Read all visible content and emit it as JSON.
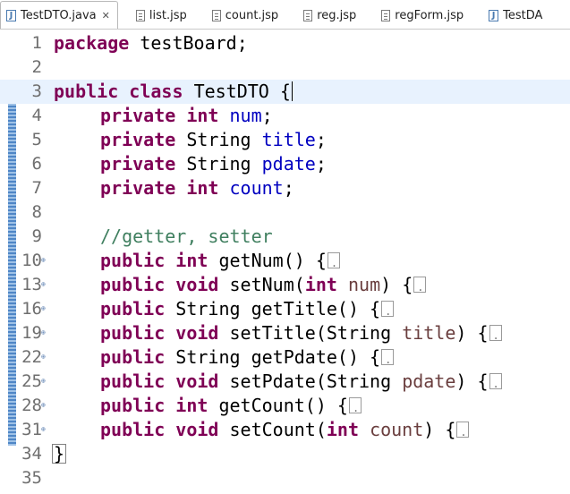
{
  "tabs": [
    {
      "label": "TestDTO.java",
      "icon": "java-file-icon",
      "active": true,
      "closable": true
    },
    {
      "label": "list.jsp",
      "icon": "jsp-file-icon"
    },
    {
      "label": "count.jsp",
      "icon": "jsp-file-icon"
    },
    {
      "label": "reg.jsp",
      "icon": "jsp-file-icon"
    },
    {
      "label": "regForm.jsp",
      "icon": "jsp-file-icon"
    },
    {
      "label": "TestDA",
      "icon": "java-file-icon"
    }
  ],
  "close_glyph": "✕",
  "editor": {
    "lines": [
      {
        "num": "1",
        "segments": [
          [
            "kw",
            "package"
          ],
          [
            "",
            "testBoard;"
          ]
        ]
      },
      {
        "num": "2",
        "segments": []
      },
      {
        "num": "3",
        "segments": [
          [
            "kw",
            "public"
          ],
          [
            "kw",
            "class"
          ],
          [
            "",
            "TestDTO {"
          ]
        ]
      },
      {
        "num": "4",
        "segments": [
          [
            "kw",
            "private"
          ],
          [
            "kw",
            "int"
          ],
          [
            "fld",
            "num"
          ],
          [
            "",
            ";"
          ]
        ]
      },
      {
        "num": "5",
        "segments": [
          [
            "kw",
            "private"
          ],
          [
            "",
            "String"
          ],
          [
            "fld",
            "title"
          ],
          [
            "",
            ";"
          ]
        ]
      },
      {
        "num": "6",
        "segments": [
          [
            "kw",
            "private"
          ],
          [
            "",
            "String"
          ],
          [
            "fld",
            "pdate"
          ],
          [
            "",
            ";"
          ]
        ]
      },
      {
        "num": "7",
        "segments": [
          [
            "kw",
            "private"
          ],
          [
            "kw",
            "int"
          ],
          [
            "fld",
            "count"
          ],
          [
            "",
            ";"
          ]
        ]
      },
      {
        "num": "8",
        "segments": []
      },
      {
        "num": "9",
        "segments": [
          [
            "cmt",
            "//getter, setter"
          ]
        ]
      },
      {
        "num": "10",
        "segments": [
          [
            "kw",
            "public"
          ],
          [
            "kw",
            "int"
          ],
          [
            "",
            "getNum() {"
          ]
        ]
      },
      {
        "num": "13",
        "segments": [
          [
            "kw",
            "public"
          ],
          [
            "kw",
            "void"
          ],
          [
            "",
            "setNum("
          ],
          [
            "kw",
            "int"
          ],
          [
            "param",
            "num"
          ],
          [
            "",
            ") {"
          ]
        ]
      },
      {
        "num": "16",
        "segments": [
          [
            "kw",
            "public"
          ],
          [
            "",
            "String getTitle() {"
          ]
        ]
      },
      {
        "num": "19",
        "segments": [
          [
            "kw",
            "public"
          ],
          [
            "kw",
            "void"
          ],
          [
            "",
            "setTitle(String"
          ],
          [
            "param",
            "title"
          ],
          [
            "",
            ") {"
          ]
        ]
      },
      {
        "num": "22",
        "segments": [
          [
            "kw",
            "public"
          ],
          [
            "",
            "String getPdate() {"
          ]
        ]
      },
      {
        "num": "25",
        "segments": [
          [
            "kw",
            "public"
          ],
          [
            "kw",
            "void"
          ],
          [
            "",
            "setPdate(String"
          ],
          [
            "param",
            "pdate"
          ],
          [
            "",
            ") {"
          ]
        ]
      },
      {
        "num": "28",
        "segments": [
          [
            "kw",
            "public"
          ],
          [
            "kw",
            "int"
          ],
          [
            "",
            "getCount() {"
          ]
        ]
      },
      {
        "num": "31",
        "segments": [
          [
            "kw",
            "public"
          ],
          [
            "kw",
            "void"
          ],
          [
            "",
            "setCount("
          ],
          [
            "kw",
            "int"
          ],
          [
            "param",
            "count"
          ],
          [
            "",
            ") {"
          ]
        ]
      },
      {
        "num": "34",
        "segments": [
          [
            "",
            "}"
          ]
        ]
      },
      {
        "num": "35",
        "segments": []
      }
    ]
  },
  "colors": {
    "keyword": "#7f0055",
    "field": "#0000c0",
    "comment": "#3f7f5f",
    "param": "#6a3e3e",
    "current_line": "#e8f2fe"
  }
}
